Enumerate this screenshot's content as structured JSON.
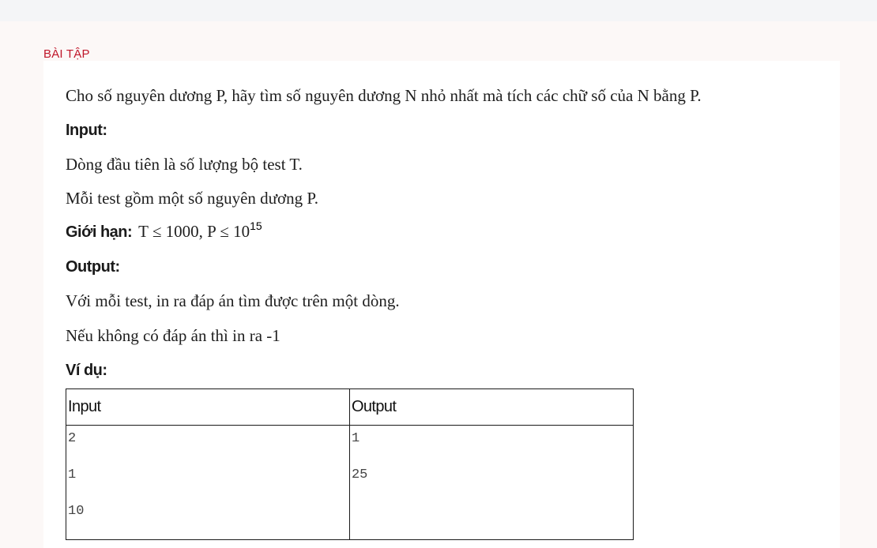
{
  "section_label": "BÀI TẬP",
  "problem": {
    "statement": "Cho số nguyên dương P, hãy tìm số nguyên dương N nhỏ nhất mà tích các chữ số của N bằng P.",
    "input_heading": "Input:",
    "input_lines": [
      "Dòng đầu tiên là số lượng bộ test T.",
      "Mỗi test gồm một số nguyên dương P."
    ],
    "limit_label": "Giới hạn:",
    "limit_expr": "T ≤ 1000, P ≤ 10",
    "limit_exponent": "15",
    "output_heading": "Output:",
    "output_lines": [
      "Với mỗi test, in ra đáp án tìm được trên một dòng.",
      "Nếu không có đáp án thì in ra -1"
    ],
    "example_heading": "Ví dụ:"
  },
  "example_table": {
    "headers": [
      "Input",
      "Output"
    ],
    "input_lines": [
      "2",
      "1",
      "10"
    ],
    "output_lines": [
      "1",
      "25"
    ]
  }
}
